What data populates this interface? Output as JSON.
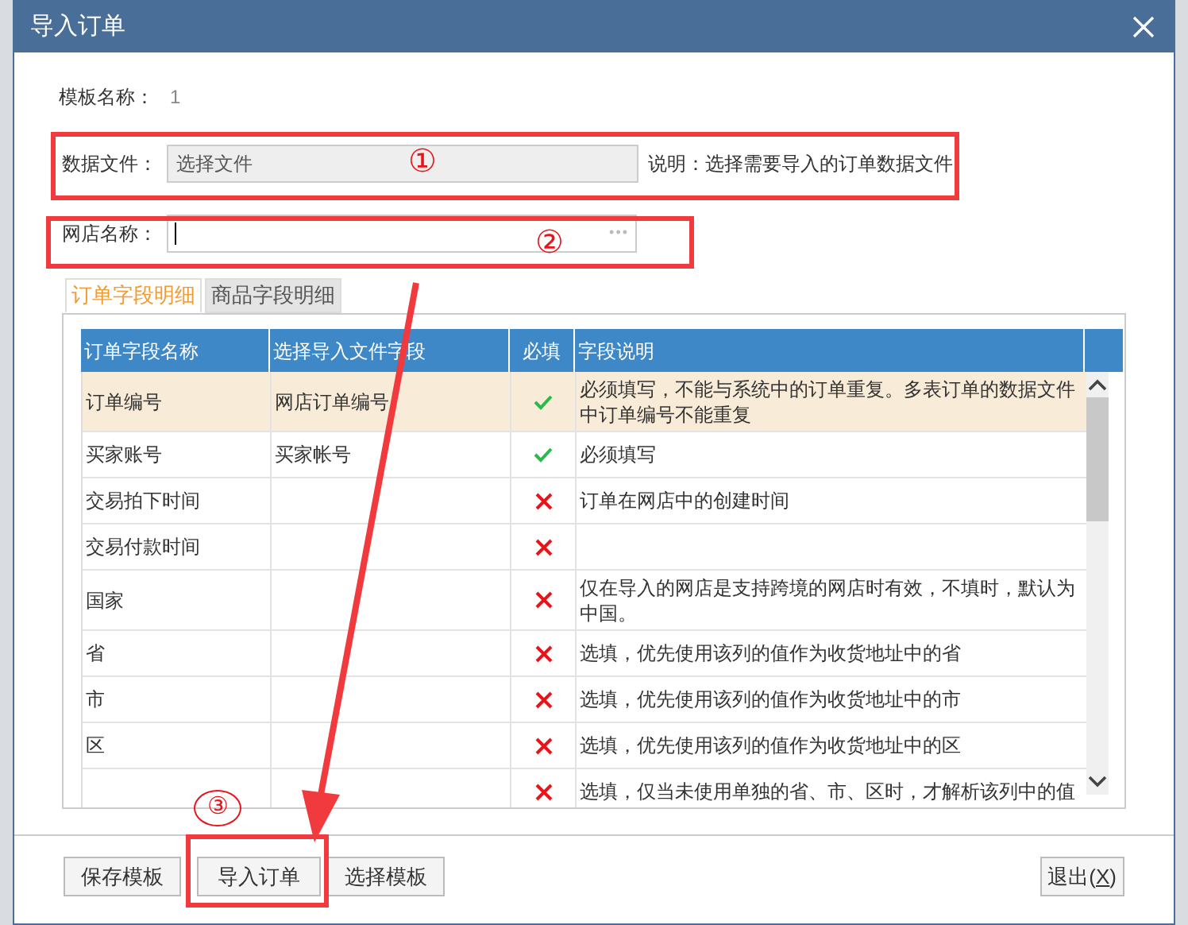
{
  "window": {
    "title": "导入订单"
  },
  "template": {
    "label": "模板名称：",
    "value": "1"
  },
  "data_file": {
    "label": "数据文件：",
    "placeholder": "选择文件",
    "note": "说明：选择需要导入的订单数据文件"
  },
  "shop": {
    "label": "网店名称：",
    "more": "•••"
  },
  "tabs": [
    {
      "label": "订单字段明细",
      "selected": true
    },
    {
      "label": "商品字段明细",
      "selected": false
    }
  ],
  "table": {
    "columns": [
      "订单字段名称",
      "选择导入文件字段",
      "必填",
      "字段说明"
    ],
    "rows": [
      {
        "name": "订单编号",
        "file_field": "网店订单编号",
        "required": true,
        "selected": true,
        "desc": "必须填写，不能与系统中的订单重复。多表订单的数据文件中订单编号不能重复"
      },
      {
        "name": "买家账号",
        "file_field": "买家帐号",
        "required": true,
        "selected": false,
        "desc": "必须填写"
      },
      {
        "name": "交易拍下时间",
        "required": false,
        "selected": false,
        "desc": "订单在网店中的创建时间"
      },
      {
        "name": "交易付款时间",
        "required": false,
        "selected": false
      },
      {
        "name": "国家",
        "required": false,
        "selected": false,
        "desc": "仅在导入的网店是支持跨境的网店时有效，不填时，默认为中国。"
      },
      {
        "name": "省",
        "required": false,
        "selected": false,
        "desc": "选填，优先使用该列的值作为收货地址中的省"
      },
      {
        "name": "市",
        "required": false,
        "selected": false,
        "desc": "选填，优先使用该列的值作为收货地址中的市"
      },
      {
        "name": "区",
        "required": false,
        "selected": false,
        "desc": "选填，优先使用该列的值作为收货地址中的区"
      },
      {
        "required": false,
        "selected": false,
        "desc": "选填，仅当未使用单独的省、市、区时，才解析该列中的值"
      }
    ]
  },
  "buttons": [
    {
      "label": "保存模板"
    },
    {
      "label": "导入订单"
    },
    {
      "label": "选择模板"
    }
  ],
  "exit": {
    "label": "退出(",
    "key": "X",
    "end": ")"
  },
  "annotations": [
    "①",
    "②",
    "③"
  ]
}
